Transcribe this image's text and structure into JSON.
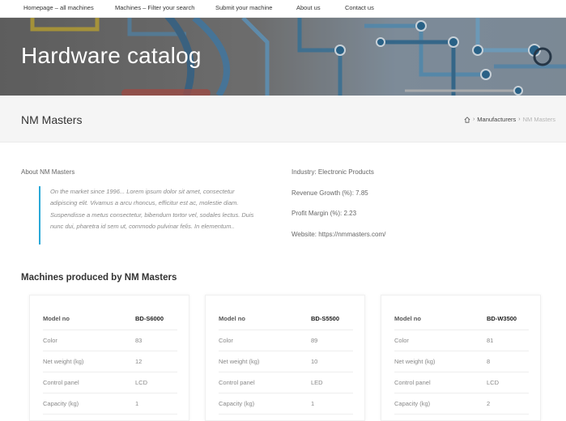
{
  "nav": {
    "items": [
      {
        "label": "Homepage – all machines"
      },
      {
        "label": "Machines – Filter your search"
      },
      {
        "label": "Submit your machine"
      },
      {
        "label": "About us"
      },
      {
        "label": "Contact us"
      }
    ]
  },
  "hero": {
    "title": "Hardware catalog"
  },
  "page": {
    "title": "NM Masters",
    "breadcrumb": {
      "home_icon": "home-icon",
      "link": "Manufacturers",
      "current": "NM Masters"
    }
  },
  "about": {
    "heading": "About NM Masters",
    "quote": "On the market since 1996... Lorem ipsum dolor sit amet, consectetur adipiscing elit. Vivamus a arcu rhoncus, efficitur est ac, molestie diam. Suspendisse a metus consectetur, bibendum tortor vel, sodales lectus. Duis nunc dui, pharetra id sem ut, commodo pulvinar felis. In elementum..",
    "quote_border_color": "#29a8d8"
  },
  "facts": {
    "industry": "Industry: Electronic Products",
    "revenue": "Revenue Growth (%): 7.85",
    "margin": "Profit Margin (%): 2.23",
    "website": "Website: https://nmmasters.com/"
  },
  "machines": {
    "heading": "Machines produced by NM Masters",
    "labels": {
      "model": "Model no",
      "color": "Color",
      "weight": "Net weight (kg)",
      "panel": "Control panel",
      "capacity": "Capacity (kg)"
    },
    "cards": [
      {
        "model": "BD-S6000",
        "color": "83",
        "weight": "12",
        "panel": "LCD",
        "capacity": "1"
      },
      {
        "model": "BD-S5500",
        "color": "89",
        "weight": "10",
        "panel": "LED",
        "capacity": "1"
      },
      {
        "model": "BD-W3500",
        "color": "81",
        "weight": "8",
        "panel": "LCD",
        "capacity": "2"
      }
    ]
  }
}
